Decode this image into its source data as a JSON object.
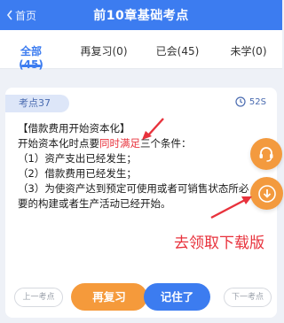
{
  "header": {
    "back_label": "首页",
    "title": "前10章基础考点"
  },
  "tabs": [
    {
      "label": "全部(45)"
    },
    {
      "label": "再复习(0)"
    },
    {
      "label": "已会(45)"
    },
    {
      "label": "未学(0)"
    }
  ],
  "card": {
    "tag": "考点37",
    "timer": "52S",
    "lines": {
      "title": "【借款费用开始资本化】",
      "line1_pre": "开始资本化时点要",
      "line1_highlight": "同时满足",
      "line1_post": "三个条件：",
      "item1": "（1）资产支出已经发生；",
      "item2": "（2）借款费用已经发生；",
      "item3": "（3）为使资产达到预定可使用或者可销售状态所必要的构建或者生产活动已经开始。"
    }
  },
  "annotation": {
    "text": "去领取下载版"
  },
  "bottom": {
    "prev_label": "上一考点",
    "review_label": "再复习",
    "remember_label": "记住了",
    "next_label": "下一考点"
  },
  "colors": {
    "accent_blue": "#3c7cf0",
    "accent_orange": "#f59a3b",
    "highlight_red": "#e8323c"
  }
}
